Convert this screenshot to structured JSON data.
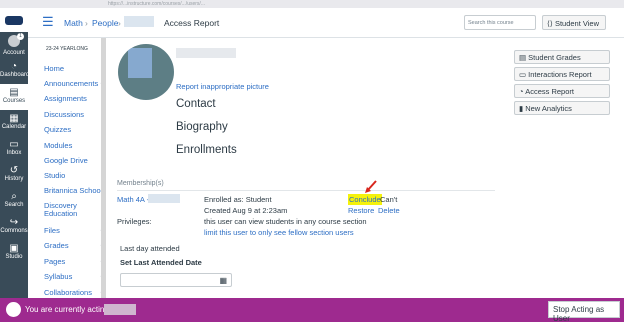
{
  "browser": {
    "url": "https://...instructure.com/courses/.../users/..."
  },
  "global_nav": {
    "items": [
      {
        "label": "Account",
        "icon": "account-icon",
        "badge": "1"
      },
      {
        "label": "Dashboard",
        "icon": "dashboard-icon"
      },
      {
        "label": "Courses",
        "icon": "courses-icon"
      },
      {
        "label": "Calendar",
        "icon": "calendar-icon"
      },
      {
        "label": "Inbox",
        "icon": "inbox-icon"
      },
      {
        "label": "History",
        "icon": "history-icon"
      },
      {
        "label": "Search",
        "icon": "search-icon"
      },
      {
        "label": "Commons",
        "icon": "commons-icon"
      },
      {
        "label": "Studio",
        "icon": "studio-icon"
      }
    ]
  },
  "breadcrumb": {
    "course": "Math",
    "people": "People",
    "current": "Access Report"
  },
  "header": {
    "search_placeholder": "Search this course",
    "student_view": "Student View"
  },
  "course_nav": {
    "term": "23-24 YEARLONG",
    "items": [
      "Home",
      "Announcements",
      "Assignments",
      "Discussions",
      "Quizzes",
      "Modules",
      "Google Drive",
      "Studio",
      "Britannica School",
      "Discovery Education",
      "Files",
      "Grades",
      "Pages",
      "Syllabus",
      "Collaborations"
    ]
  },
  "profile": {
    "report_link": "Report inappropriate picture",
    "contact": "Contact",
    "biography": "Biography",
    "enrollments": "Enrollments"
  },
  "rail": {
    "student_grades": "Student Grades",
    "interactions_report": "Interactions Report",
    "access_report": "Access Report",
    "new_analytics": "New Analytics"
  },
  "membership": {
    "title": "Membership(s)",
    "course": "Math 4A -",
    "enrolled_as": "Enrolled as: Student",
    "created": "Created Aug 9 at 2:23am",
    "conclude": "Conclude",
    "cant": "Can't",
    "restore": "Restore",
    "delete": "Delete",
    "privileges_label": "Privileges:",
    "privileges_text": "this user can view students in any course section",
    "limit_link": "limit this user to only see fellow section users"
  },
  "attendance": {
    "last_day_label": "Last day attended",
    "set_last_label": "Set Last Attended Date"
  },
  "acting_bar": {
    "text": "You are currently acting a",
    "stop_button": "Stop Acting as User"
  },
  "colors": {
    "link": "#2d6ec4",
    "nav_bg": "#394b58",
    "acting_bar": "#9e2a8f",
    "highlight": "#f5f20c"
  }
}
